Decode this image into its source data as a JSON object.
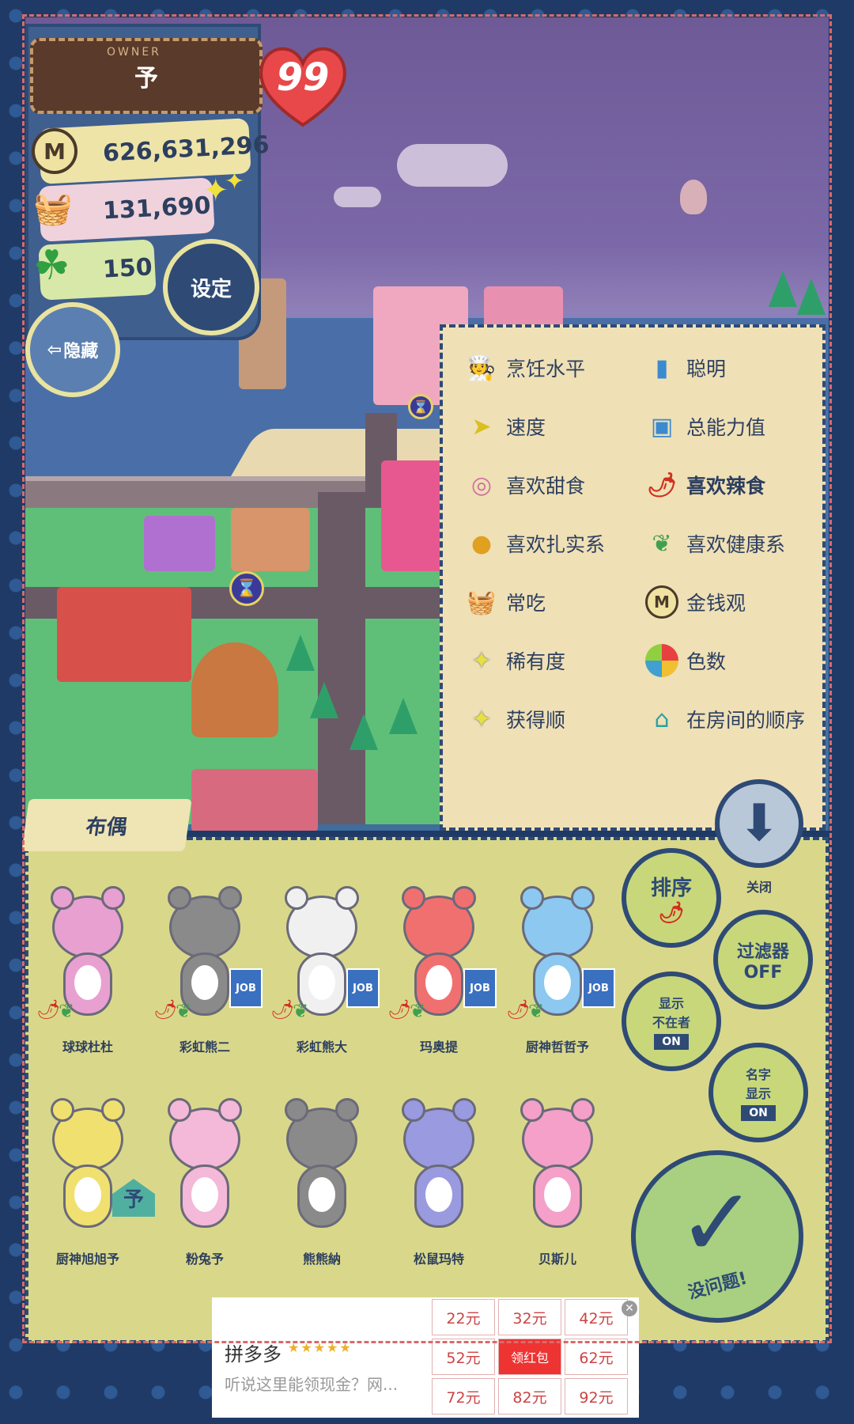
{
  "owner": {
    "label": "OWNER",
    "name": "予",
    "level": "99",
    "money": "626,631,296",
    "food": "131,690",
    "clover": "150",
    "settings_label": "设定",
    "hide_label": "隐藏"
  },
  "legend": {
    "items": [
      {
        "label": "烹饪水平",
        "icon": "chef-hat-icon"
      },
      {
        "label": "聪明",
        "icon": "book-icon"
      },
      {
        "label": "速度",
        "icon": "speed-icon"
      },
      {
        "label": "总能力值",
        "icon": "total-ability-icon"
      },
      {
        "label": "喜欢甜食",
        "icon": "lollipop-icon"
      },
      {
        "label": "喜欢辣食",
        "icon": "chili-icon"
      },
      {
        "label": "喜欢扎实系",
        "icon": "hearty-food-icon"
      },
      {
        "label": "喜欢健康系",
        "icon": "leaf-icon"
      },
      {
        "label": "常吃",
        "icon": "food-basket-icon"
      },
      {
        "label": "金钱观",
        "icon": "coin-icon"
      },
      {
        "label": "稀有度",
        "icon": "sparkle-icon"
      },
      {
        "label": "色数",
        "icon": "color-wheel-icon"
      },
      {
        "label": "获得顺",
        "icon": "sparkle-icon"
      },
      {
        "label": "在房间的顺序",
        "icon": "house-icon"
      }
    ]
  },
  "doll_panel": {
    "tab_label": "布偶",
    "close_label": "关闭",
    "sort_label": "排序",
    "filter_label": "过滤器",
    "filter_state": "OFF",
    "show_absent_label": "显示\n不在者",
    "show_absent_state": "ON",
    "show_name_label": "名字\n显示",
    "show_name_state": "ON",
    "ok_label": "没问题!",
    "job_badge": "JOB",
    "room_badge": "予",
    "dolls_row1": [
      {
        "name": "球球杜杜",
        "color": "#e8a0d0",
        "job": false
      },
      {
        "name": "彩虹熊二",
        "color": "#8a8a8a",
        "job": true
      },
      {
        "name": "彩虹熊大",
        "color": "#f0f0f0",
        "job": true
      },
      {
        "name": "玛奥提",
        "color": "#f07070",
        "job": true
      },
      {
        "name": "厨神哲哲予",
        "color": "#8cc8f0",
        "job": true
      }
    ],
    "dolls_row2": [
      {
        "name": "厨神旭旭予",
        "color": "#f0e070"
      },
      {
        "name": "粉兔予",
        "color": "#f4b8d8"
      },
      {
        "name": "熊熊納",
        "color": "#8a8a8a"
      },
      {
        "name": "松鼠玛特",
        "color": "#9a9ae0"
      },
      {
        "name": "贝斯儿",
        "color": "#f4a0c8"
      }
    ]
  },
  "ad": {
    "brand": "拼多多",
    "subtitle": "听说这里能领现金？网...",
    "cells": [
      "22元",
      "32元",
      "42元",
      "52元",
      "领红包",
      "62元",
      "72元",
      "82元",
      "92元"
    ]
  }
}
